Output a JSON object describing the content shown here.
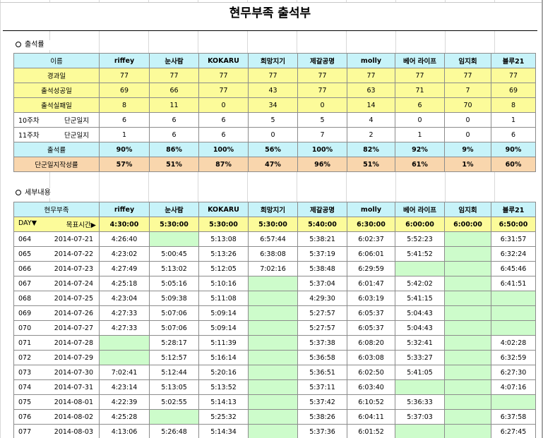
{
  "title": "현무부족 출석부",
  "summary": {
    "section_label": "출석률",
    "name_header": "이름",
    "members": [
      "riffey",
      "눈사람",
      "KOKARU",
      "희망지기",
      "제갈공명",
      "molly",
      "베어 라이프",
      "임지회",
      "블루21"
    ],
    "rows": [
      {
        "label": "경과일",
        "values": [
          "77",
          "77",
          "77",
          "77",
          "77",
          "77",
          "77",
          "77",
          "77"
        ]
      },
      {
        "label": "출석성공일",
        "values": [
          "69",
          "66",
          "77",
          "43",
          "77",
          "63",
          "71",
          "7",
          "69"
        ]
      },
      {
        "label": "출석실패일",
        "values": [
          "8",
          "11",
          "0",
          "34",
          "0",
          "14",
          "6",
          "70",
          "8"
        ]
      }
    ],
    "week_rows": [
      {
        "week": "10주차",
        "label": "단군일지",
        "values": [
          "6",
          "6",
          "6",
          "5",
          "5",
          "4",
          "0",
          "0",
          "1"
        ]
      },
      {
        "week": "11주차",
        "label": "단군일지",
        "values": [
          "1",
          "6",
          "6",
          "0",
          "7",
          "2",
          "1",
          "0",
          "6"
        ]
      }
    ],
    "rate_row": {
      "label": "출석률",
      "values": [
        "90%",
        "86%",
        "100%",
        "56%",
        "100%",
        "82%",
        "92%",
        "9%",
        "90%"
      ]
    },
    "journal_row": {
      "label": "단군일지작성률",
      "values": [
        "57%",
        "51%",
        "87%",
        "47%",
        "96%",
        "51%",
        "61%",
        "1%",
        "60%"
      ]
    }
  },
  "detail": {
    "section_label": "세부내용",
    "group_header": "현무부족",
    "members": [
      "riffey",
      "눈사람",
      "KOKARU",
      "희망지기",
      "제갈공명",
      "molly",
      "베어 라이프",
      "임지회",
      "블루21"
    ],
    "day_label": "DAY▼",
    "target_label": "목표시간▶",
    "targets": [
      "4:30:00",
      "5:30:00",
      "5:30:00",
      "5:30:00",
      "5:40:00",
      "6:30:00",
      "6:00:00",
      "6:00:00",
      "6:50:00"
    ],
    "rows": [
      {
        "day": "064",
        "date": "2014-07-21",
        "times": [
          "4:26:40",
          "",
          "5:13:08",
          "6:57:44",
          "5:38:21",
          "6:02:37",
          "5:52:23",
          "",
          "6:31:57"
        ]
      },
      {
        "day": "065",
        "date": "2014-07-22",
        "times": [
          "4:23:02",
          "5:00:45",
          "5:13:26",
          "6:38:08",
          "5:37:19",
          "6:06:01",
          "5:41:52",
          "",
          "6:32:24"
        ]
      },
      {
        "day": "066",
        "date": "2014-07-23",
        "times": [
          "4:27:49",
          "5:13:02",
          "5:12:05",
          "7:02:16",
          "5:38:48",
          "6:29:59",
          "",
          "",
          "6:45:46"
        ]
      },
      {
        "day": "067",
        "date": "2014-07-24",
        "times": [
          "4:25:18",
          "5:05:16",
          "5:10:16",
          "",
          "5:37:04",
          "6:01:47",
          "5:42:02",
          "",
          "6:41:51"
        ]
      },
      {
        "day": "068",
        "date": "2014-07-25",
        "times": [
          "4:23:04",
          "5:09:38",
          "5:11:08",
          "",
          "4:29:30",
          "6:03:19",
          "5:41:15",
          "",
          ""
        ]
      },
      {
        "day": "069",
        "date": "2014-07-26",
        "times": [
          "4:27:33",
          "5:07:06",
          "5:09:14",
          "",
          "5:27:57",
          "6:05:37",
          "5:04:43",
          "",
          ""
        ]
      },
      {
        "day": "070",
        "date": "2014-07-27",
        "times": [
          "4:27:33",
          "5:07:06",
          "5:09:14",
          "",
          "5:27:57",
          "6:05:37",
          "5:04:43",
          "",
          ""
        ]
      },
      {
        "day": "071",
        "date": "2014-07-28",
        "times": [
          "",
          "5:28:17",
          "5:11:39",
          "",
          "5:37:38",
          "6:08:20",
          "5:32:41",
          "",
          "4:02:28"
        ]
      },
      {
        "day": "072",
        "date": "2014-07-29",
        "times": [
          "",
          "5:12:57",
          "5:16:14",
          "",
          "5:36:58",
          "6:03:08",
          "5:33:27",
          "",
          "6:32:59"
        ]
      },
      {
        "day": "073",
        "date": "2014-07-30",
        "times": [
          "7:02:41",
          "5:12:44",
          "5:20:16",
          "",
          "5:36:51",
          "6:02:50",
          "5:41:05",
          "",
          "6:27:30"
        ]
      },
      {
        "day": "074",
        "date": "2014-07-31",
        "times": [
          "4:23:14",
          "5:13:05",
          "5:13:52",
          "",
          "5:37:11",
          "6:03:40",
          "",
          "",
          "4:07:16"
        ]
      },
      {
        "day": "075",
        "date": "2014-08-01",
        "times": [
          "4:22:39",
          "5:02:55",
          "5:14:13",
          "",
          "5:37:42",
          "6:10:52",
          "5:36:33",
          "",
          ""
        ]
      },
      {
        "day": "076",
        "date": "2014-08-02",
        "times": [
          "4:25:28",
          "",
          "5:25:32",
          "",
          "5:38:26",
          "6:04:11",
          "5:37:03",
          "",
          "6:37:58"
        ]
      },
      {
        "day": "077",
        "date": "2014-08-03",
        "times": [
          "4:13:06",
          "5:26:48",
          "5:14:34",
          "",
          "5:37:36",
          "6:01:52",
          "",
          "",
          "6:27:45"
        ]
      }
    ]
  },
  "colors": {
    "header_cyan": "#c7f3f9",
    "highlight_yellow": "#fcfb9a",
    "journal_tan": "#f9d6ad",
    "empty_green": "#cdfccb"
  }
}
